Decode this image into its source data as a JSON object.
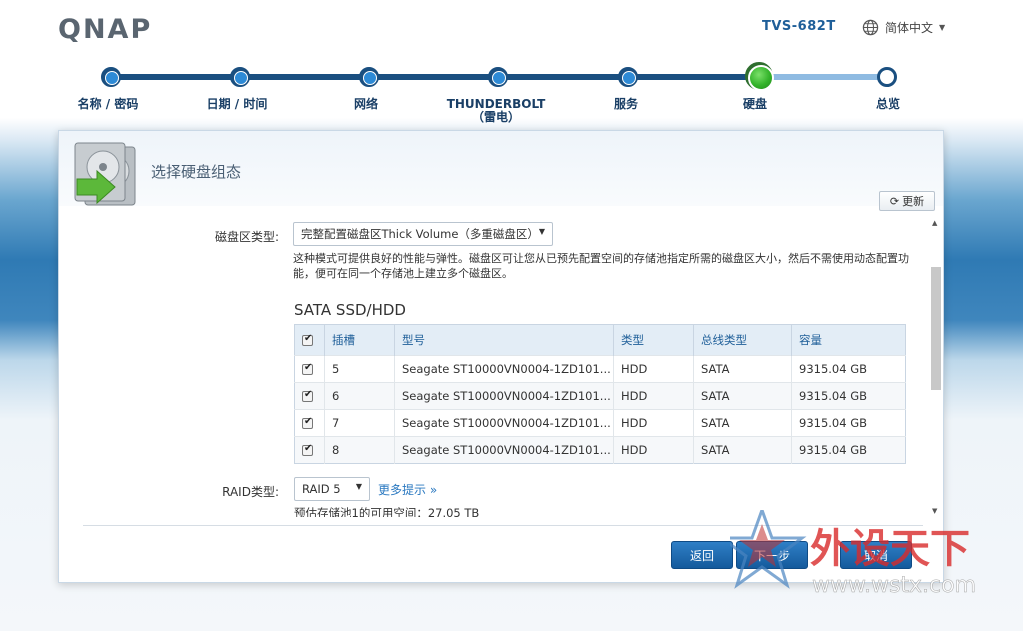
{
  "header": {
    "logo_text": "QNAP",
    "model": "TVS-682T",
    "language": "简体中文"
  },
  "wizard": {
    "steps": [
      {
        "label": "名称 / 密码",
        "state": "done"
      },
      {
        "label": "日期 / 时间",
        "state": "done"
      },
      {
        "label": "网络",
        "state": "done"
      },
      {
        "label": "THUNDERBOLT（雷电）",
        "state": "done"
      },
      {
        "label": "服务",
        "state": "done"
      },
      {
        "label": "硬盘",
        "state": "current"
      },
      {
        "label": "总览",
        "state": "future"
      }
    ]
  },
  "panel": {
    "title": "选择硬盘组态",
    "refresh_label": "更新",
    "volume_type": {
      "label": "磁盘区类型:",
      "value": "完整配置磁盘区Thick Volume（多重磁盘区）"
    },
    "description": "这种模式可提供良好的性能与弹性。磁盘区可让您从已预先配置空间的存储池指定所需的磁盘区大小，然后不需使用动态配置功能，便可在同一个存储池上建立多个磁盘区。",
    "section_title": "SATA SSD/HDD",
    "table": {
      "headers": [
        "插槽",
        "型号",
        "类型",
        "总线类型",
        "容量"
      ],
      "rows": [
        {
          "slot": "5",
          "model": "Seagate ST10000VN0004-1ZD101...",
          "type": "HDD",
          "bus": "SATA",
          "capacity": "9315.04 GB"
        },
        {
          "slot": "6",
          "model": "Seagate ST10000VN0004-1ZD101...",
          "type": "HDD",
          "bus": "SATA",
          "capacity": "9315.04 GB"
        },
        {
          "slot": "7",
          "model": "Seagate ST10000VN0004-1ZD101...",
          "type": "HDD",
          "bus": "SATA",
          "capacity": "9315.04 GB"
        },
        {
          "slot": "8",
          "model": "Seagate ST10000VN0004-1ZD101...",
          "type": "HDD",
          "bus": "SATA",
          "capacity": "9315.04 GB"
        }
      ]
    },
    "raid": {
      "label": "RAID类型:",
      "value": "RAID 5",
      "more_tips": "更多提示 »"
    },
    "capacity_text": "预估存储池1的可用空间：27.05 TB",
    "buttons": {
      "back": "返回",
      "next": "下一步",
      "cancel": "取消"
    }
  },
  "watermark": {
    "text": "外设天下",
    "url": "www.wstx.com"
  },
  "colors": {
    "accent": "#1f5f99",
    "step_done": "#1a4f80",
    "step_current": "#33b32a",
    "button": "#1f6fb4"
  }
}
